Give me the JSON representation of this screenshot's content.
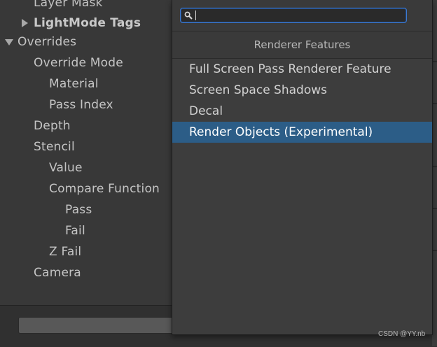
{
  "inspector": {
    "rows": [
      "Layer Mask",
      "LightMode Tags",
      "Overrides",
      "Override Mode",
      "Material",
      "Pass Index",
      "Depth",
      "Stencil",
      "Value",
      "Compare Function",
      "Pass",
      "Fail",
      "Z Fail",
      "Camera"
    ]
  },
  "popup": {
    "search": {
      "value": "",
      "placeholder": ""
    },
    "header": "Renderer Features",
    "items": [
      "Full Screen Pass Renderer Feature",
      "Screen Space Shadows",
      "Decal",
      "Render Objects (Experimental)"
    ],
    "selected_item": "Render Objects (Experimental)"
  },
  "watermark": "CSDN @YY.nb",
  "colors": {
    "background": "#383838",
    "popup_background": "#3d3d3d",
    "selection": "#2c5d87",
    "focus_border": "#3d7ad0",
    "text": "#c4c4c4"
  }
}
